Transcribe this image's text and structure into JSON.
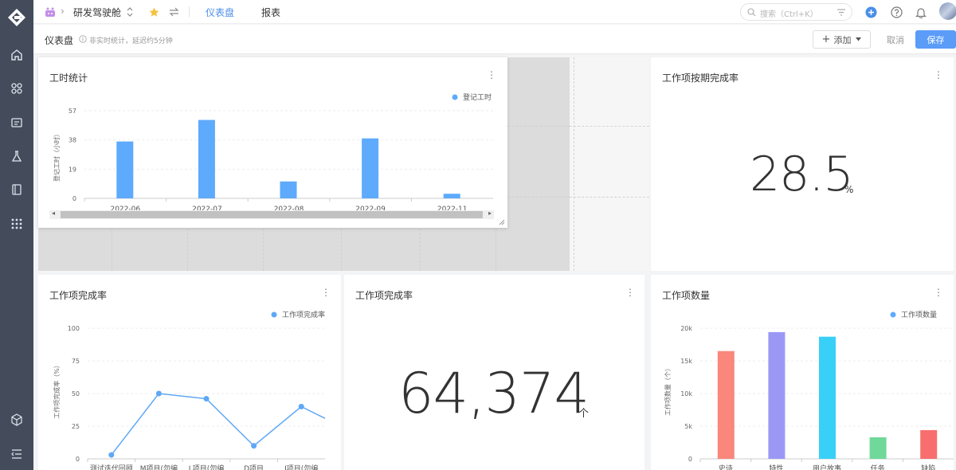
{
  "topbar": {
    "project": "研发驾驶舱",
    "tabs": [
      "仪表盘",
      "报表"
    ],
    "search_placeholder": "搜索（Ctrl+K）"
  },
  "header": {
    "title": "仪表盘",
    "note": "非实时统计，延迟约5分钟",
    "add_label": "添加",
    "cancel_label": "取消",
    "save_label": "保存"
  },
  "colors": {
    "accent": "#5a9cf8",
    "bar_blue": "#5eaafc",
    "line_blue": "#5ea8f5"
  },
  "cards": {
    "hours": {
      "title": "工时统计",
      "legend": "登记工时",
      "ylabel": "登记工时（小时）"
    },
    "ontime": {
      "title": "工作项按期完成率",
      "value": "28.5",
      "unit": "%"
    },
    "completion_line": {
      "title": "工作项完成率",
      "legend": "工作项完成率",
      "ylabel": "工作项完成率（%）"
    },
    "completion_num": {
      "title": "工作项完成率",
      "value": "64,374",
      "unit": "个"
    },
    "count": {
      "title": "工作项数量",
      "legend": "工作项数量",
      "ylabel": "工作项数量（个）"
    }
  },
  "chart_data": [
    {
      "type": "bar",
      "title": "工时统计",
      "ylabel": "登记工时（小时）",
      "categories": [
        "2022-06",
        "2022-07",
        "2022-08",
        "2022-09",
        "2022-11"
      ],
      "series": [
        {
          "name": "登记工时",
          "values": [
            37,
            51,
            11,
            39,
            3
          ]
        }
      ],
      "yticks": [
        "0",
        "19",
        "38",
        "57"
      ],
      "ylim": [
        0,
        57
      ]
    },
    {
      "type": "line",
      "title": "工作项完成率",
      "ylabel": "工作项完成率（%）",
      "categories": [
        "测试迭代回顾",
        "M项目(勿编",
        "L项目(勿编",
        "D项目",
        "J项目(勿编"
      ],
      "series": [
        {
          "name": "工作项完成率",
          "values": [
            3,
            50,
            46,
            10,
            40
          ]
        }
      ],
      "yticks": [
        "0",
        "25",
        "50",
        "75",
        "100"
      ],
      "ylim": [
        0,
        100
      ]
    },
    {
      "type": "bar",
      "title": "工作项数量",
      "ylabel": "工作项数量（个）",
      "categories": [
        "史诗",
        "特性",
        "用户故事",
        "任务",
        "缺陷"
      ],
      "series": [
        {
          "name": "工作项数量",
          "values": [
            16500,
            19400,
            18700,
            3300,
            4400
          ]
        }
      ],
      "bar_colors": [
        "#f9877c",
        "#9b98f5",
        "#38d0f7",
        "#6fd89a",
        "#f86e6e"
      ],
      "yticks": [
        "0",
        "5k",
        "10k",
        "15k",
        "20k"
      ],
      "ylim": [
        0,
        20000
      ]
    }
  ]
}
